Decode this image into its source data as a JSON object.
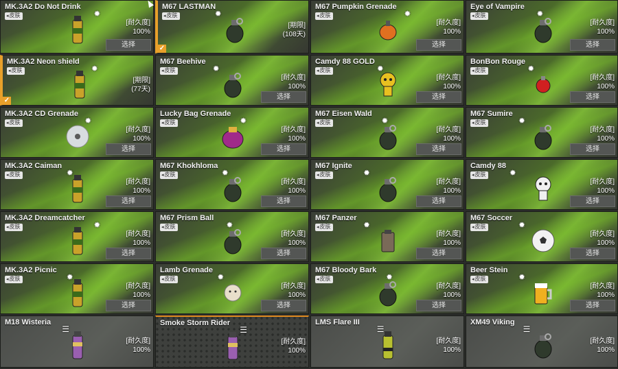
{
  "common": {
    "skin_tag": "皮肤",
    "durability_label": "[耐久度]",
    "select_label": "选择",
    "check": "✓"
  },
  "items": [
    {
      "id": "c1",
      "name": "MK.3A2 Do Not Drink",
      "tag": true,
      "line1": "[耐久度]",
      "line2": "100%",
      "select": true,
      "icon": "grenade-can-icon"
    },
    {
      "id": "c2",
      "name": "MK.3A2 Neon shield",
      "tag": true,
      "line1": "[期限]",
      "line2": "(77天)",
      "select": false,
      "icon": "grenade-can-icon",
      "checked": true
    },
    {
      "id": "c3",
      "name": "MK.3A2 CD Grenade",
      "tag": true,
      "line1": "[耐久度]",
      "line2": "100%",
      "select": true,
      "icon": "cd-disc-icon"
    },
    {
      "id": "c4",
      "name": "MK.3A2 Caiman",
      "tag": true,
      "line1": "[耐久度]",
      "line2": "100%",
      "select": true,
      "icon": "grenade-can-icon"
    },
    {
      "id": "c5",
      "name": "MK.3A2 Dreamcatcher",
      "tag": true,
      "line1": "[耐久度]",
      "line2": "100%",
      "select": true,
      "icon": "grenade-can-icon"
    },
    {
      "id": "c6",
      "name": "MK.3A2 Picnic",
      "tag": true,
      "line1": "[耐久度]",
      "line2": "100%",
      "select": true,
      "icon": "grenade-can-icon"
    },
    {
      "id": "c7",
      "name": "M18 Wisteria",
      "tag": false,
      "line1": "[耐久度]",
      "line2": "100%",
      "select": false,
      "icon": "smoke-can-icon"
    },
    {
      "id": "d1",
      "name": "M67 LASTMAN",
      "tag": true,
      "line1": "[期限]",
      "line2": "(108天)",
      "select": false,
      "icon": "grenade-round-icon",
      "checked": true
    },
    {
      "id": "d2",
      "name": "M67 Beehive",
      "tag": true,
      "line1": "[耐久度]",
      "line2": "100%",
      "select": true,
      "icon": "grenade-round-icon"
    },
    {
      "id": "d3",
      "name": "Lucky Bag Grenade",
      "tag": true,
      "line1": "[耐久度]",
      "line2": "100%",
      "select": true,
      "icon": "lucky-bag-icon"
    },
    {
      "id": "d4",
      "name": "M67 Khokhloma",
      "tag": true,
      "line1": "[耐久度]",
      "line2": "100%",
      "select": true,
      "icon": "grenade-round-icon"
    },
    {
      "id": "d5",
      "name": "M67 Prism Ball",
      "tag": true,
      "line1": "[耐久度]",
      "line2": "100%",
      "select": true,
      "icon": "grenade-round-icon"
    },
    {
      "id": "d6",
      "name": "Lamb Grenade",
      "tag": true,
      "line1": "[耐久度]",
      "line2": "100%",
      "select": true,
      "icon": "lamb-icon"
    },
    {
      "id": "d7",
      "name": "Smoke Storm Rider",
      "tag": false,
      "line1": "[耐久度]",
      "line2": "100%",
      "select": false,
      "icon": "smoke-can-icon"
    },
    {
      "id": "e1",
      "name": "M67 Pumpkin Grenade",
      "tag": true,
      "line1": "[耐久度]",
      "line2": "100%",
      "select": true,
      "icon": "pumpkin-icon"
    },
    {
      "id": "e2",
      "name": "Camdy 88 GOLD",
      "tag": true,
      "line1": "[耐久度]",
      "line2": "100%",
      "select": true,
      "icon": "gold-mascot-icon"
    },
    {
      "id": "e3",
      "name": "M67 Eisen Wald",
      "tag": true,
      "line1": "[耐久度]",
      "line2": "100%",
      "select": true,
      "icon": "grenade-round-icon"
    },
    {
      "id": "e4",
      "name": "M67 Ignite",
      "tag": true,
      "line1": "[耐久度]",
      "line2": "100%",
      "select": true,
      "icon": "grenade-round-icon"
    },
    {
      "id": "e5",
      "name": "M67 Panzer",
      "tag": true,
      "line1": "[耐久度]",
      "line2": "100%",
      "select": true,
      "icon": "grenade-box-icon"
    },
    {
      "id": "e6",
      "name": "M67 Bloody Bark",
      "tag": true,
      "line1": "[耐久度]",
      "line2": "100%",
      "select": true,
      "icon": "grenade-round-icon"
    },
    {
      "id": "e7",
      "name": "LMS Flare III",
      "tag": false,
      "line1": "[耐久度]",
      "line2": "100%",
      "select": false,
      "icon": "flare-can-icon"
    },
    {
      "id": "f1",
      "name": "Eye of Vampire",
      "tag": true,
      "line1": "[耐久度]",
      "line2": "100%",
      "select": true,
      "icon": "grenade-round-icon"
    },
    {
      "id": "f2",
      "name": "BonBon Rouge",
      "tag": true,
      "line1": "[耐久度]",
      "line2": "100%",
      "select": true,
      "icon": "candy-icon"
    },
    {
      "id": "f3",
      "name": "M67 Sumire",
      "tag": true,
      "line1": "[耐久度]",
      "line2": "100%",
      "select": true,
      "icon": "grenade-round-icon"
    },
    {
      "id": "f4",
      "name": "Camdy 88",
      "tag": true,
      "line1": "[耐久度]",
      "line2": "100%",
      "select": true,
      "icon": "white-mascot-icon"
    },
    {
      "id": "f5",
      "name": "M67 Soccer",
      "tag": true,
      "line1": "[耐久度]",
      "line2": "100%",
      "select": true,
      "icon": "soccer-ball-icon"
    },
    {
      "id": "f6",
      "name": "Beer Stein",
      "tag": true,
      "line1": "[耐久度]",
      "line2": "100%",
      "select": true,
      "icon": "beer-mug-icon"
    },
    {
      "id": "f7",
      "name": "XM49 Viking",
      "tag": false,
      "line1": "[耐久度]",
      "line2": "100%",
      "select": false,
      "icon": "grenade-round-icon"
    }
  ],
  "colors": {
    "accent": "#e8a02a",
    "grass": "#7bb13a",
    "button": "#545654"
  }
}
